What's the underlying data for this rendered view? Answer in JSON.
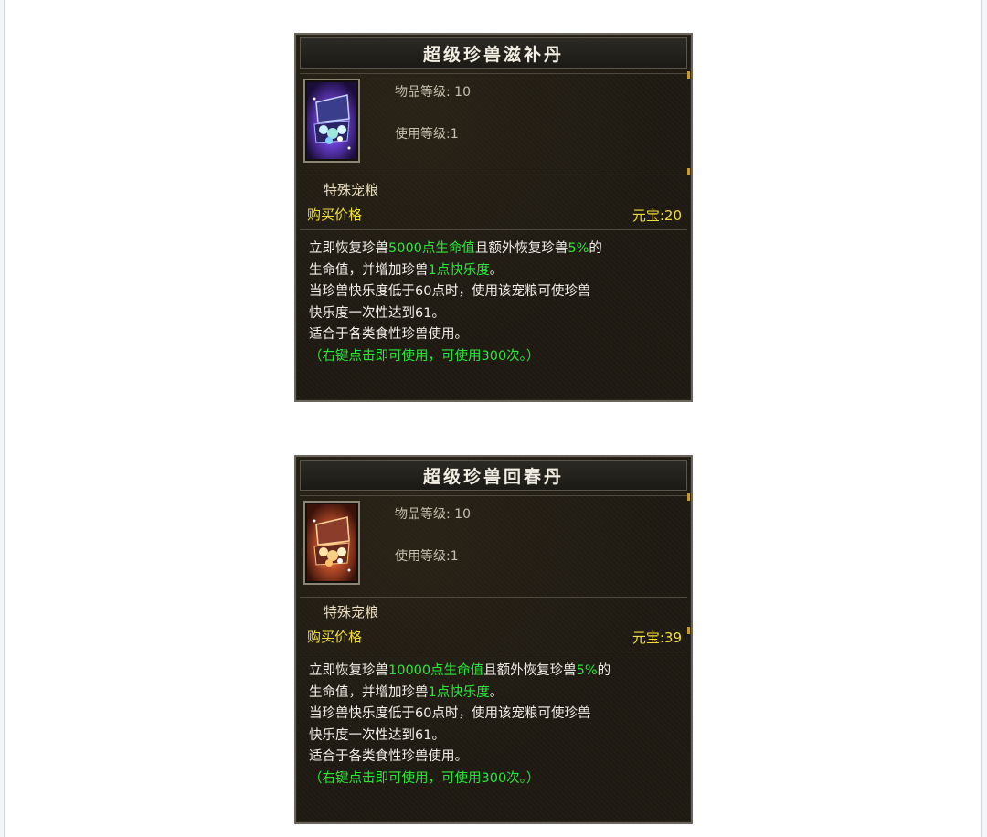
{
  "items": [
    {
      "title": "超级珍兽滋补丹",
      "item_level_label": "物品等级:",
      "item_level": "10",
      "use_level_label": "使用等级:",
      "use_level": "1",
      "kind": "特殊宠粮",
      "price_label": "购买价格",
      "price_currency": "元宝:",
      "price": "20",
      "desc_1a": "立即恢复珍兽",
      "desc_1b": "5000点生命值",
      "desc_1c": "且额外恢复珍兽",
      "desc_1d": "5%",
      "desc_1e": "的",
      "desc_2a": "生命值，并增加珍兽",
      "desc_2b": "1点快乐度",
      "desc_2c": "。",
      "desc_3": "当珍兽快乐度低于60点时，使用该宠粮可使珍兽",
      "desc_4": "快乐度一次性达到61。",
      "desc_5": "适合于各类食性珍兽使用。",
      "footer": "（右键点击即可使用，可使用300次。）",
      "icon": "treasure-chest-purple-icon"
    },
    {
      "title": "超级珍兽回春丹",
      "item_level_label": "物品等级:",
      "item_level": "10",
      "use_level_label": "使用等级:",
      "use_level": "1",
      "kind": "特殊宠粮",
      "price_label": "购买价格",
      "price_currency": "元宝:",
      "price": "39",
      "desc_1a": "立即恢复珍兽",
      "desc_1b": "10000点生命值",
      "desc_1c": "且额外恢复珍兽",
      "desc_1d": "5%",
      "desc_1e": "的",
      "desc_2a": "生命值，并增加珍兽",
      "desc_2b": "1点快乐度",
      "desc_2c": "。",
      "desc_3": "当珍兽快乐度低于60点时，使用该宠粮可使珍兽",
      "desc_4": "快乐度一次性达到61。",
      "desc_5": "适合于各类食性珍兽使用。",
      "footer": "（右键点击即可使用，可使用300次。）",
      "icon": "treasure-chest-gold-icon"
    }
  ],
  "colors": {
    "highlight_green": "#2ee63a",
    "price_yellow": "#f2de3a",
    "panel_bg": "#1e1a12"
  }
}
